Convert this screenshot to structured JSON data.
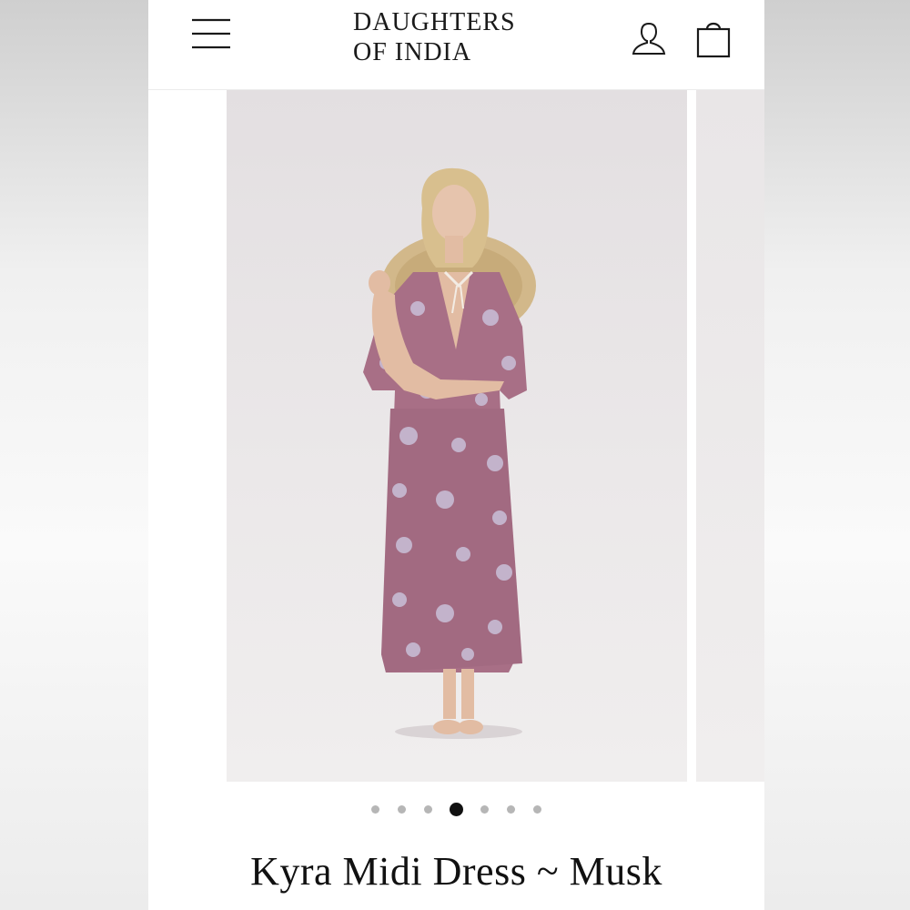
{
  "header": {
    "brand_line1": "DAUGHTERS",
    "brand_line2": "OF INDIA",
    "menu_icon": "hamburger-menu-icon",
    "account_icon": "user-account-icon",
    "bag_icon": "shopping-bag-icon"
  },
  "gallery": {
    "slide_count": 7,
    "active_index": 4,
    "zoom_icon": "magnifier-icon"
  },
  "product": {
    "title": "Kyra Midi Dress ~ Musk"
  },
  "colors": {
    "text": "#111111",
    "dot_inactive": "#b6b6b6",
    "dot_active": "#111111",
    "dress": "#a86f86",
    "backdrop": "#e8e5e6"
  }
}
